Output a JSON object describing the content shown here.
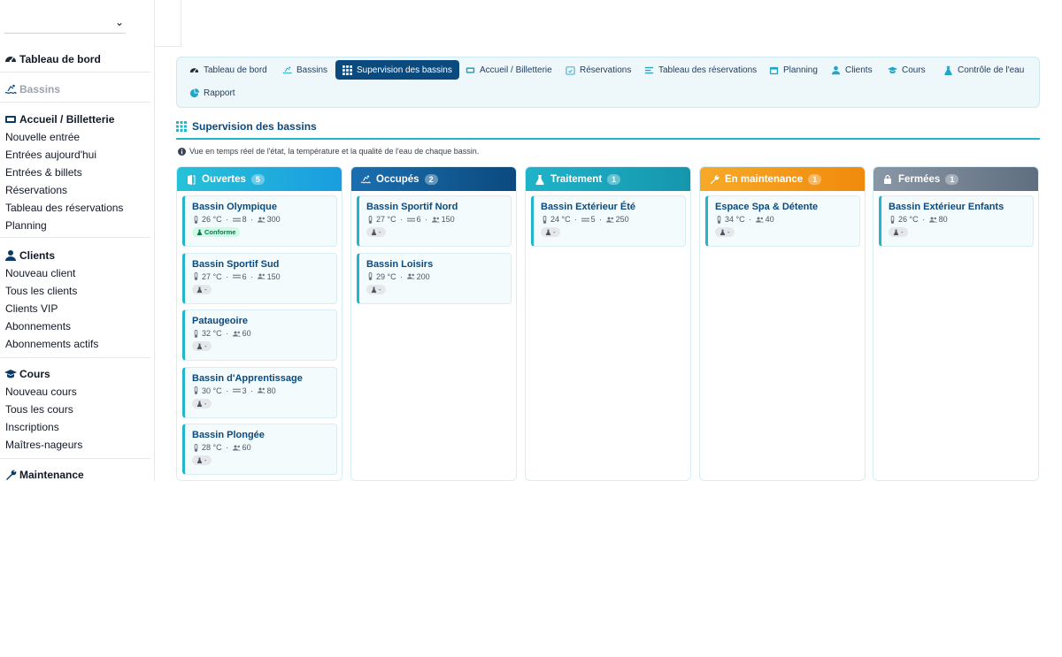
{
  "sidebar": {
    "sections": [
      {
        "title": "Tableau de bord",
        "items": []
      },
      {
        "title": "Bassins",
        "items": []
      },
      {
        "title": "Accueil / Billetterie",
        "items": [
          "Nouvelle entrée",
          "Entrées aujourd'hui",
          "Entrées & billets",
          "Réservations",
          "Tableau des réservations",
          "Planning"
        ]
      },
      {
        "title": "Clients",
        "items": [
          "Nouveau client",
          "Tous les clients",
          "Clients VIP",
          "Abonnements",
          "Abonnements actifs"
        ]
      },
      {
        "title": "Cours",
        "items": [
          "Nouveau cours",
          "Tous les cours",
          "Inscriptions",
          "Maîtres-nageurs"
        ]
      },
      {
        "title": "Maintenance",
        "items": []
      }
    ]
  },
  "nav": {
    "items": [
      "Tableau de bord",
      "Bassins",
      "Supervision des bassins",
      "Accueil / Billetterie",
      "Réservations",
      "Tableau des réservations",
      "Planning",
      "Clients",
      "Cours",
      "Contrôle de l'eau",
      "Rapport"
    ],
    "active": "Supervision des bassins"
  },
  "page": {
    "title": "Supervision des bassins",
    "description": "Vue en temps réel de l'état, la température et la qualité de l'eau de chaque bassin."
  },
  "columns": [
    {
      "title": "Ouvertes",
      "count": "5",
      "color": "#22b5e0",
      "cards": [
        {
          "name": "Bassin Olympique",
          "temp": "26 °C",
          "lanes": "8",
          "capacity": "300",
          "quality": "Conforme"
        },
        {
          "name": "Bassin Sportif Sud",
          "temp": "27 °C",
          "lanes": "6",
          "capacity": "150",
          "quality": "-"
        },
        {
          "name": "Pataugeoire",
          "temp": "32 °C",
          "lanes": "",
          "capacity": "60",
          "quality": "-"
        },
        {
          "name": "Bassin d'Apprentissage",
          "temp": "30 °C",
          "lanes": "3",
          "capacity": "80",
          "quality": "-"
        },
        {
          "name": "Bassin Plongée",
          "temp": "28 °C",
          "lanes": "",
          "capacity": "60",
          "quality": "-"
        }
      ]
    },
    {
      "title": "Occupés",
      "count": "2",
      "color": "#0b5a9a",
      "cards": [
        {
          "name": "Bassin Sportif Nord",
          "temp": "27 °C",
          "lanes": "6",
          "capacity": "150",
          "quality": "-"
        },
        {
          "name": "Bassin Loisirs",
          "temp": "29 °C",
          "lanes": "",
          "capacity": "200",
          "quality": "-"
        }
      ]
    },
    {
      "title": "Traitement",
      "count": "1",
      "color": "#17a2b8",
      "cards": [
        {
          "name": "Bassin Extérieur Été",
          "temp": "24 °C",
          "lanes": "5",
          "capacity": "250",
          "quality": "-"
        }
      ]
    },
    {
      "title": "En maintenance",
      "count": "1",
      "color": "#f39c12",
      "cards": [
        {
          "name": "Espace Spa & Détente",
          "temp": "34 °C",
          "lanes": "",
          "capacity": "40",
          "quality": "-"
        }
      ]
    },
    {
      "title": "Fermées",
      "count": "1",
      "color": "#6c7a89",
      "cards": [
        {
          "name": "Bassin Extérieur Enfants",
          "temp": "26 °C",
          "lanes": "",
          "capacity": "80",
          "quality": "-"
        }
      ]
    }
  ]
}
